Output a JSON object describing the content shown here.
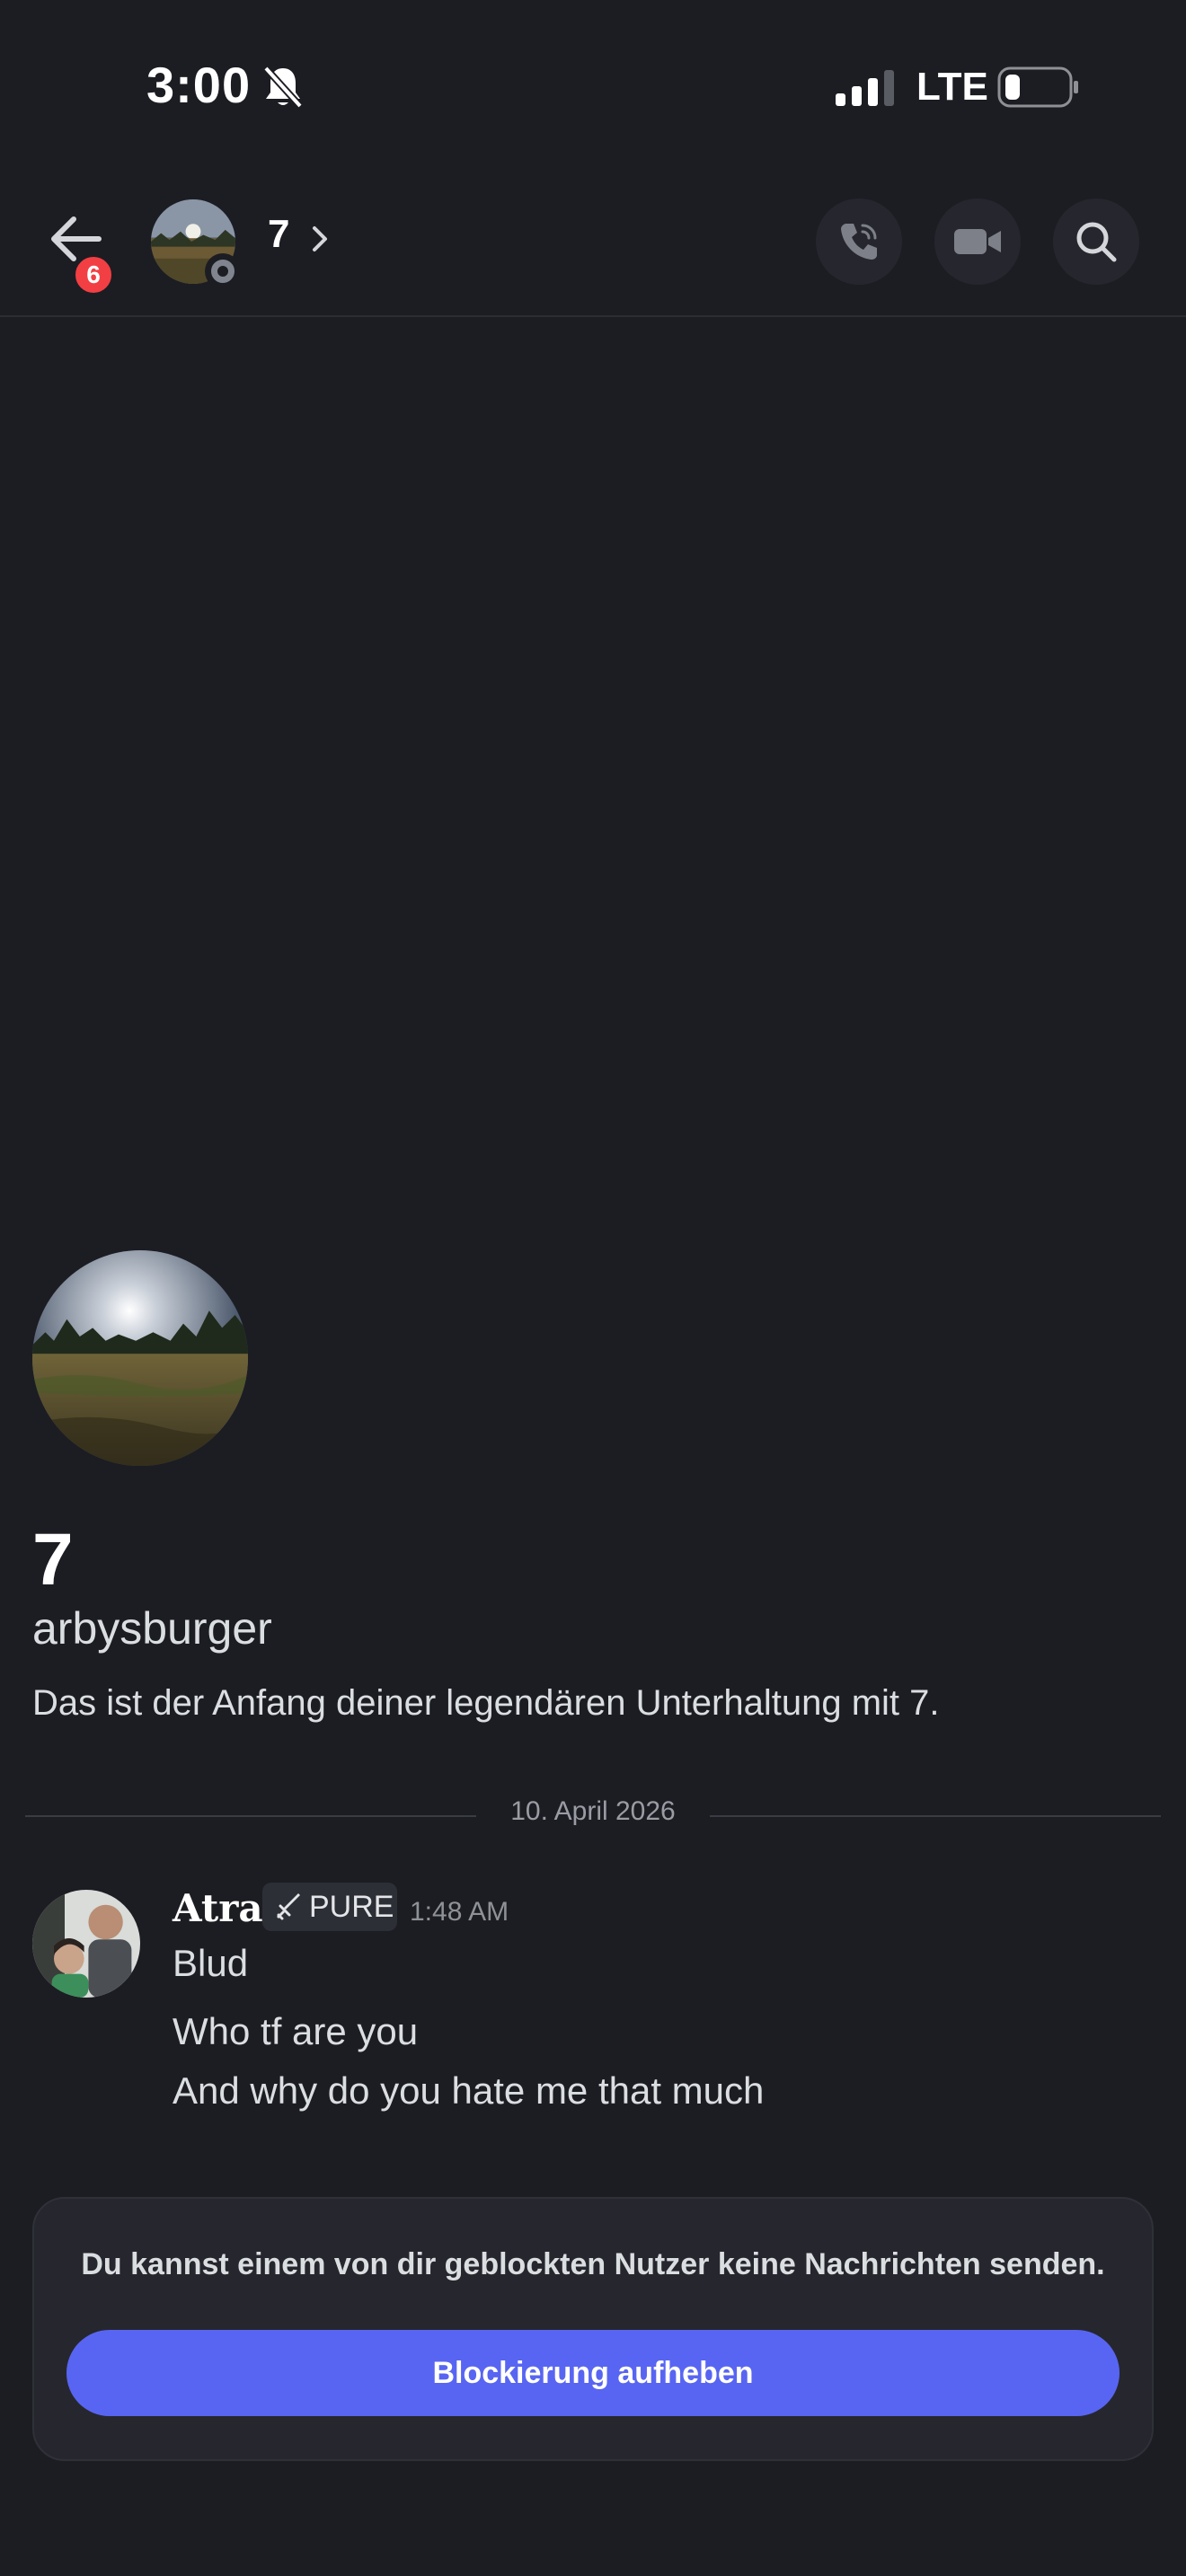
{
  "status_bar": {
    "time": "3:00",
    "network": "LTE"
  },
  "header": {
    "unread_badge": "6",
    "title": "7"
  },
  "profile": {
    "display_name": "7",
    "username": "arbysburger",
    "intro": "Das ist der Anfang deiner legendären Unterhaltung mit 7."
  },
  "divider": {
    "date": "10. April 2026"
  },
  "message": {
    "author": "Atra",
    "tag": "PURE",
    "time": "1:48 AM",
    "lines": [
      "Blud",
      "Who tf are you",
      "And why do you hate me that much"
    ]
  },
  "blocked_panel": {
    "text": "Du kannst einem von dir geblockten Nutzer keine Nachrichten senden.",
    "button": "Blockierung aufheben"
  },
  "colors": {
    "background": "#1c1d23",
    "accent": "#5865f2",
    "badge": "#f23f43"
  }
}
